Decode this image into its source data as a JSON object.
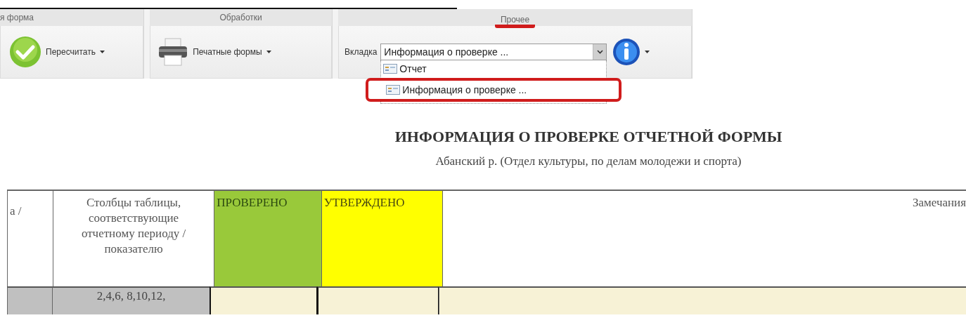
{
  "ribbon": {
    "groups": [
      {
        "title": "я форма",
        "annotated": false,
        "items": [
          {
            "kind": "button",
            "label": "Пересчитать"
          }
        ]
      },
      {
        "title": "Обработки",
        "annotated": false,
        "items": [
          {
            "kind": "button",
            "label": "Печатные формы"
          }
        ]
      },
      {
        "title": "Прочее",
        "annotated": true,
        "items": [
          {
            "kind": "select",
            "label": "Вкладка",
            "value": "Информация о проверке ...",
            "expanded": true,
            "options": [
              {
                "label": "Отчет",
                "annotated": false
              },
              {
                "label": "Информация о проверке ...",
                "annotated": true
              }
            ]
          },
          {
            "kind": "button"
          }
        ]
      }
    ]
  },
  "report": {
    "title": "ИНФОРМАЦИЯ О ПРОВЕРКЕ ОТЧЕТНОЙ ФОРМЫ",
    "subtitle": "Абанский р. (Отдел культуры, по делам молодежи и спорта)"
  },
  "table": {
    "columns": [
      {
        "label": "а /",
        "color": "#ffffff"
      },
      {
        "label": "Столбцы таблицы, соответствующие отчетному периоду / показателю",
        "color": "#ffffff"
      },
      {
        "label": "ПРОВЕРЕНО",
        "color": "#99c93a"
      },
      {
        "label": "УТВЕРЖДЕНО",
        "color": "#ffff00"
      },
      {
        "label": "Замечания",
        "color": "#ffffff"
      }
    ],
    "rows": [
      {
        "cells": [
          {
            "color": "#c0c0c0"
          },
          {
            "color": "#c0c0c0",
            "text": "2,4,6, 8,10,12,"
          },
          {
            "color": "#f7f2d6"
          },
          {
            "color": "#f7f2d6"
          },
          {
            "color": "#f7f2d6"
          }
        ]
      }
    ]
  }
}
